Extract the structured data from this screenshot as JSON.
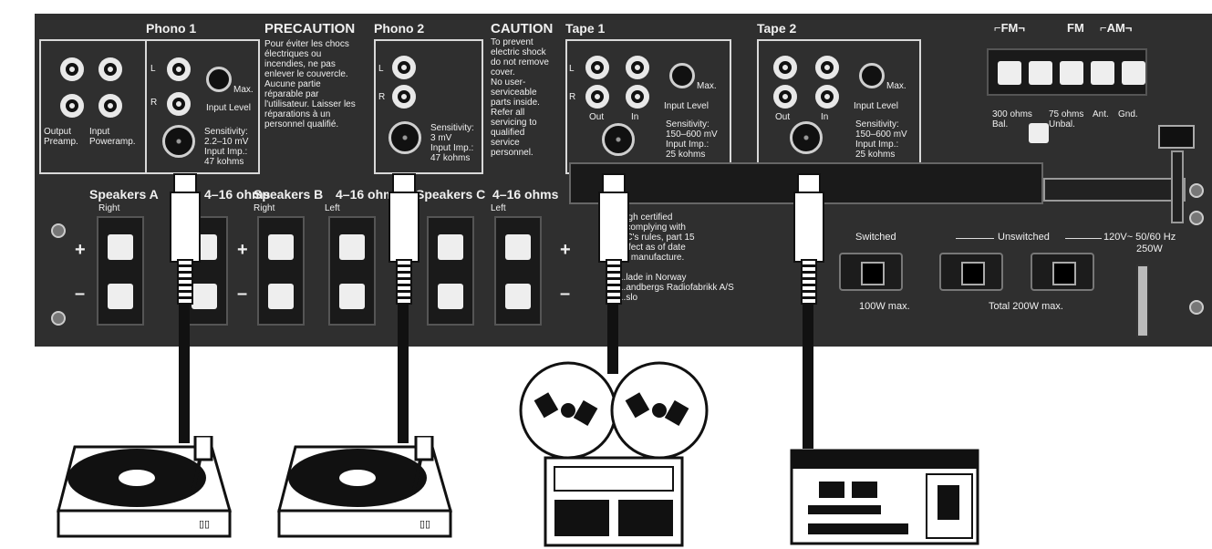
{
  "phono1": {
    "title": "Phono 1",
    "L": "L",
    "R": "R",
    "max": "Max.",
    "input_level": "Input Level",
    "out_label": "Output\nPreamp.",
    "in_label": "Input\nPoweramp.",
    "sensitivity": "Sensitivity:\n2.2–10 mV\nInput Imp.:\n47 kohms"
  },
  "precaution": {
    "title": "PRECAUTION",
    "text": "Pour éviter les chocs\nélectriques ou\nincendies, ne pas\nenlever le couvercle.\nAucune partie\nréparable par\nl'utilisateur. Laisser les\nréparations à un\npersonnel qualifié."
  },
  "phono2": {
    "title": "Phono 2",
    "L": "L",
    "R": "R",
    "sensitivity": "Sensitivity:\n3 mV\nInput Imp.:\n47 kohms"
  },
  "caution": {
    "title": "CAUTION",
    "text": "To prevent\nelectric shock\ndo not remove\ncover.\nNo user-\nserviceable\nparts inside.\nRefer all\nservicing to\nqualified\nservice\npersonnel."
  },
  "tape1": {
    "title": "Tape 1",
    "L": "L",
    "R": "R",
    "max": "Max.",
    "input_level": "Input Level",
    "out": "Out",
    "in": "In",
    "sensitivity": "Sensitivity:\n150–600 mV\nInput Imp.:\n25 kohms"
  },
  "tape2": {
    "title": "Tape 2",
    "max": "Max.",
    "input_level": "Input Level",
    "out": "Out",
    "in": "In",
    "sensitivity": "Sensitivity:\n150–600 mV\nInput Imp.:\n25 kohms"
  },
  "antenna": {
    "fm_bal": "⌐FM¬",
    "fm": "FM",
    "am": "⌐AM¬",
    "ohms300": "300 ohms\nBal.",
    "ohms75": "75 ohms\nUnbal.",
    "ant": "Ant.",
    "gnd": "Gnd."
  },
  "speakers": {
    "a": "Speakers A",
    "a_ohms": "4–16 ohms",
    "b": "Speakers B",
    "b_ohms": "4–16 ohms",
    "c": "Speakers C",
    "c_ohms": "4–16 ohms",
    "right": "Right",
    "left": "Left",
    "plus": "+",
    "minus": "–"
  },
  "compliance": "...igh certified\n...complying with\n...C's rules, part 15\n...ffect as of date\n...f manufacture.\n\n...lade in Norway\n...andbergs Radiofabrikk A/S\n...slo",
  "power": {
    "switched": "Switched",
    "unswitched": "Unswitched",
    "voltage": "120V~ 50/60 Hz",
    "watts": "250W",
    "max100": "100W max.",
    "total": "Total 200W max."
  }
}
